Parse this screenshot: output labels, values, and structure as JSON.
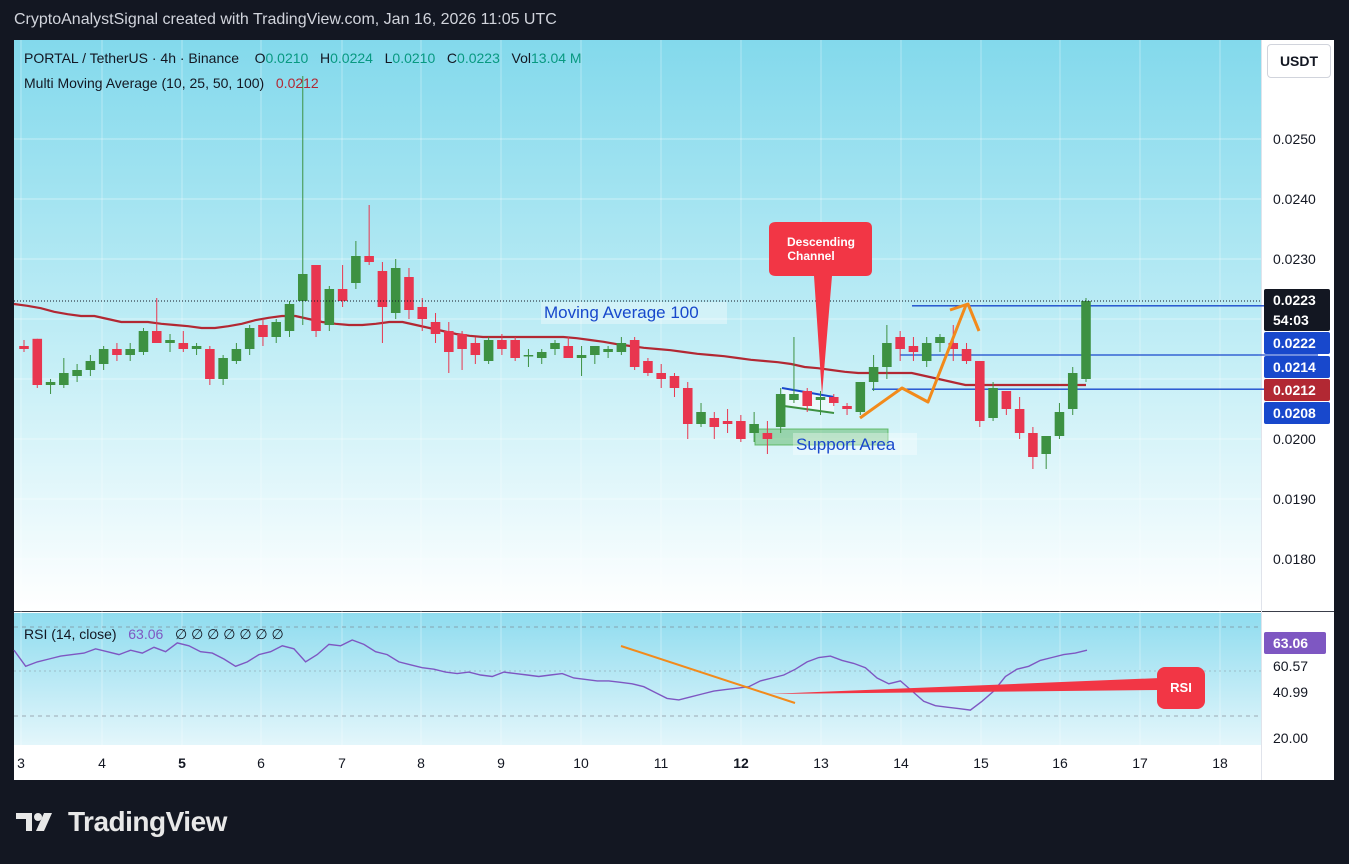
{
  "header": {
    "credit": "CryptoAnalystSignal created with TradingView.com, Jan 16, 2026 11:05 UTC"
  },
  "legend": {
    "symbol": "PORTAL / TetherUS · 4h · Binance",
    "o_label": "O",
    "o_value": "0.0210",
    "h_label": "H",
    "h_value": "0.0224",
    "l_label": "L",
    "l_value": "0.0210",
    "c_label": "C",
    "c_value": "0.0223",
    "vol_label": "Vol",
    "vol_value": "13.04 M",
    "ma_label": "Multi Moving Average (10, 25, 50, 100)",
    "ma_value": "0.0212"
  },
  "currency_button": "USDT",
  "rsi_legend": {
    "label": "RSI (14, close)",
    "value": "63.06",
    "extra": "∅ ∅ ∅ ∅ ∅ ∅ ∅"
  },
  "annotations": {
    "moving_average": "Moving Average 100",
    "support_area": "Support Area",
    "descending_channel_line1": "Descending",
    "descending_channel_line2": "Channel",
    "rsi_callout": "RSI"
  },
  "price_badges": {
    "last": "0.0223",
    "countdown": "54:03",
    "level_upper": "0.0222",
    "level_mid": "0.0214",
    "ma100": "0.0212",
    "level_lower": "0.0208"
  },
  "rsi_badges": {
    "current": "63.06",
    "b1": "60.57",
    "b2": "40.99",
    "b3": "20.00"
  },
  "colors": {
    "up": "#3d9142",
    "down": "#e8364f",
    "ma100": "#b22833",
    "rsi": "#7e57c2",
    "annotation_blue": "#1848cc",
    "annotation_orange": "#f28a1b",
    "callout_red": "#f23645"
  },
  "brand": {
    "name": "TradingView",
    "icon": "tradingview-logo-icon"
  },
  "chart_data": [
    {
      "type": "candlestick",
      "price_axis": {
        "ticks": [
          "0.0180",
          "0.0190",
          "0.0200",
          "0.0230",
          "0.0240",
          "0.0250"
        ],
        "ylim": [
          0.0172,
          0.0262
        ]
      },
      "time_axis": {
        "ticks": [
          "3",
          "4",
          "5",
          "6",
          "7",
          "8",
          "9",
          "10",
          "11",
          "12",
          "13",
          "14",
          "15",
          "16",
          "17",
          "18"
        ]
      },
      "grid": true,
      "candles": [
        {
          "o": 0.02155,
          "h": 0.02165,
          "l": 0.02145,
          "c": 0.0215
        },
        {
          "o": 0.02167,
          "h": 0.02167,
          "l": 0.02085,
          "c": 0.0209
        },
        {
          "o": 0.0209,
          "h": 0.021,
          "l": 0.02075,
          "c": 0.02095
        },
        {
          "o": 0.0209,
          "h": 0.02135,
          "l": 0.02085,
          "c": 0.0211
        },
        {
          "o": 0.02105,
          "h": 0.02125,
          "l": 0.02095,
          "c": 0.02115
        },
        {
          "o": 0.02115,
          "h": 0.0214,
          "l": 0.02105,
          "c": 0.0213
        },
        {
          "o": 0.02125,
          "h": 0.02155,
          "l": 0.02115,
          "c": 0.0215
        },
        {
          "o": 0.0215,
          "h": 0.0216,
          "l": 0.0213,
          "c": 0.0214
        },
        {
          "o": 0.0214,
          "h": 0.0216,
          "l": 0.0213,
          "c": 0.0215
        },
        {
          "o": 0.02145,
          "h": 0.02185,
          "l": 0.0214,
          "c": 0.0218
        },
        {
          "o": 0.0218,
          "h": 0.02235,
          "l": 0.0216,
          "c": 0.0216
        },
        {
          "o": 0.0216,
          "h": 0.02175,
          "l": 0.02145,
          "c": 0.02165
        },
        {
          "o": 0.0216,
          "h": 0.0218,
          "l": 0.02145,
          "c": 0.0215
        },
        {
          "o": 0.0215,
          "h": 0.0216,
          "l": 0.0214,
          "c": 0.02155
        },
        {
          "o": 0.0215,
          "h": 0.02155,
          "l": 0.0209,
          "c": 0.021
        },
        {
          "o": 0.021,
          "h": 0.0214,
          "l": 0.0209,
          "c": 0.02135
        },
        {
          "o": 0.0213,
          "h": 0.0216,
          "l": 0.02125,
          "c": 0.0215
        },
        {
          "o": 0.0215,
          "h": 0.0219,
          "l": 0.0214,
          "c": 0.02185
        },
        {
          "o": 0.0219,
          "h": 0.022,
          "l": 0.02155,
          "c": 0.0217
        },
        {
          "o": 0.0217,
          "h": 0.022,
          "l": 0.0216,
          "c": 0.02195
        },
        {
          "o": 0.0218,
          "h": 0.0223,
          "l": 0.0217,
          "c": 0.02225
        },
        {
          "o": 0.0223,
          "h": 0.02605,
          "l": 0.0219,
          "c": 0.02275
        },
        {
          "o": 0.0229,
          "h": 0.0229,
          "l": 0.0217,
          "c": 0.0218
        },
        {
          "o": 0.0219,
          "h": 0.02255,
          "l": 0.0218,
          "c": 0.0225
        },
        {
          "o": 0.0225,
          "h": 0.0229,
          "l": 0.0222,
          "c": 0.0223
        },
        {
          "o": 0.0226,
          "h": 0.0233,
          "l": 0.0225,
          "c": 0.02305
        },
        {
          "o": 0.02305,
          "h": 0.0239,
          "l": 0.0229,
          "c": 0.02295
        },
        {
          "o": 0.0228,
          "h": 0.02295,
          "l": 0.0216,
          "c": 0.0222
        },
        {
          "o": 0.0221,
          "h": 0.023,
          "l": 0.022,
          "c": 0.02285
        },
        {
          "o": 0.0227,
          "h": 0.02285,
          "l": 0.022,
          "c": 0.02215
        },
        {
          "o": 0.0222,
          "h": 0.02235,
          "l": 0.0218,
          "c": 0.022
        },
        {
          "o": 0.02195,
          "h": 0.0221,
          "l": 0.0216,
          "c": 0.02175
        },
        {
          "o": 0.0218,
          "h": 0.02195,
          "l": 0.0211,
          "c": 0.02145
        },
        {
          "o": 0.02175,
          "h": 0.0218,
          "l": 0.02115,
          "c": 0.0215
        },
        {
          "o": 0.0216,
          "h": 0.0217,
          "l": 0.02125,
          "c": 0.0214
        },
        {
          "o": 0.0213,
          "h": 0.0217,
          "l": 0.02125,
          "c": 0.02165
        },
        {
          "o": 0.02165,
          "h": 0.02175,
          "l": 0.0214,
          "c": 0.0215
        },
        {
          "o": 0.02165,
          "h": 0.0217,
          "l": 0.0213,
          "c": 0.02135
        },
        {
          "o": 0.0214,
          "h": 0.0215,
          "l": 0.0212,
          "c": 0.0214
        },
        {
          "o": 0.02135,
          "h": 0.0215,
          "l": 0.02125,
          "c": 0.02145
        },
        {
          "o": 0.0215,
          "h": 0.02165,
          "l": 0.0214,
          "c": 0.0216
        },
        {
          "o": 0.02155,
          "h": 0.0217,
          "l": 0.02135,
          "c": 0.02135
        },
        {
          "o": 0.02135,
          "h": 0.02155,
          "l": 0.02105,
          "c": 0.0214
        },
        {
          "o": 0.0214,
          "h": 0.02155,
          "l": 0.02125,
          "c": 0.02155
        },
        {
          "o": 0.02145,
          "h": 0.02155,
          "l": 0.02135,
          "c": 0.0215
        },
        {
          "o": 0.02145,
          "h": 0.0217,
          "l": 0.0214,
          "c": 0.0216
        },
        {
          "o": 0.02165,
          "h": 0.0217,
          "l": 0.02115,
          "c": 0.0212
        },
        {
          "o": 0.0213,
          "h": 0.02135,
          "l": 0.02105,
          "c": 0.0211
        },
        {
          "o": 0.0211,
          "h": 0.02125,
          "l": 0.02085,
          "c": 0.021
        },
        {
          "o": 0.02105,
          "h": 0.0211,
          "l": 0.0207,
          "c": 0.02085
        },
        {
          "o": 0.02085,
          "h": 0.02095,
          "l": 0.02,
          "c": 0.02025
        },
        {
          "o": 0.02025,
          "h": 0.0206,
          "l": 0.0202,
          "c": 0.02045
        },
        {
          "o": 0.02035,
          "h": 0.02045,
          "l": 0.02,
          "c": 0.0202
        },
        {
          "o": 0.0203,
          "h": 0.0205,
          "l": 0.0201,
          "c": 0.02025
        },
        {
          "o": 0.0203,
          "h": 0.0204,
          "l": 0.01995,
          "c": 0.02
        },
        {
          "o": 0.0201,
          "h": 0.02045,
          "l": 0.01995,
          "c": 0.02025
        },
        {
          "o": 0.0201,
          "h": 0.0203,
          "l": 0.01975,
          "c": 0.02
        },
        {
          "o": 0.0202,
          "h": 0.02085,
          "l": 0.0201,
          "c": 0.02075
        },
        {
          "o": 0.02065,
          "h": 0.0217,
          "l": 0.0206,
          "c": 0.02075
        },
        {
          "o": 0.0208,
          "h": 0.02085,
          "l": 0.02045,
          "c": 0.02055
        },
        {
          "o": 0.02065,
          "h": 0.0208,
          "l": 0.0204,
          "c": 0.0207
        },
        {
          "o": 0.0207,
          "h": 0.02075,
          "l": 0.02055,
          "c": 0.0206
        },
        {
          "o": 0.02055,
          "h": 0.0206,
          "l": 0.0204,
          "c": 0.0205
        },
        {
          "o": 0.02045,
          "h": 0.02095,
          "l": 0.0204,
          "c": 0.02095
        },
        {
          "o": 0.02095,
          "h": 0.0214,
          "l": 0.0208,
          "c": 0.0212
        },
        {
          "o": 0.0212,
          "h": 0.0219,
          "l": 0.021,
          "c": 0.0216
        },
        {
          "o": 0.0217,
          "h": 0.0218,
          "l": 0.0213,
          "c": 0.0215
        },
        {
          "o": 0.02155,
          "h": 0.0217,
          "l": 0.0213,
          "c": 0.02145
        },
        {
          "o": 0.0213,
          "h": 0.0217,
          "l": 0.0212,
          "c": 0.0216
        },
        {
          "o": 0.0216,
          "h": 0.02175,
          "l": 0.02145,
          "c": 0.0217
        },
        {
          "o": 0.0216,
          "h": 0.0219,
          "l": 0.0213,
          "c": 0.0215
        },
        {
          "o": 0.0215,
          "h": 0.0216,
          "l": 0.02125,
          "c": 0.0213
        },
        {
          "o": 0.0213,
          "h": 0.0213,
          "l": 0.0202,
          "c": 0.0203
        },
        {
          "o": 0.02035,
          "h": 0.02095,
          "l": 0.0203,
          "c": 0.02085
        },
        {
          "o": 0.0208,
          "h": 0.0208,
          "l": 0.0204,
          "c": 0.0205
        },
        {
          "o": 0.0205,
          "h": 0.0207,
          "l": 0.02,
          "c": 0.0201
        },
        {
          "o": 0.0201,
          "h": 0.0202,
          "l": 0.0195,
          "c": 0.0197
        },
        {
          "o": 0.01975,
          "h": 0.02005,
          "l": 0.0195,
          "c": 0.02005
        },
        {
          "o": 0.02005,
          "h": 0.0206,
          "l": 0.02,
          "c": 0.02045
        },
        {
          "o": 0.0205,
          "h": 0.0212,
          "l": 0.0204,
          "c": 0.0211
        },
        {
          "o": 0.021,
          "h": 0.02235,
          "l": 0.02095,
          "c": 0.0223
        }
      ],
      "moving_average_100": [
        0.02225,
        0.02222,
        0.02218,
        0.02212,
        0.02208,
        0.02205,
        0.02205,
        0.022,
        0.02195,
        0.02195,
        0.02195,
        0.02192,
        0.0219,
        0.02188,
        0.02185,
        0.02185,
        0.02188,
        0.02192,
        0.02198,
        0.02202,
        0.02205,
        0.02205,
        0.022,
        0.02195,
        0.02192,
        0.0219,
        0.0219,
        0.02192,
        0.02195,
        0.02195,
        0.0219,
        0.02185,
        0.0218,
        0.02175,
        0.02172,
        0.0217,
        0.0217,
        0.0217,
        0.0217,
        0.0217,
        0.0217,
        0.0217,
        0.02168,
        0.02165,
        0.02162,
        0.02158,
        0.02155,
        0.02152,
        0.0215,
        0.02148,
        0.02145,
        0.02142,
        0.0214,
        0.02138,
        0.02135,
        0.02132,
        0.0213,
        0.02128,
        0.02125,
        0.0212,
        0.02118,
        0.02115,
        0.02112,
        0.0211,
        0.0211,
        0.0211,
        0.0211,
        0.0211,
        0.02105,
        0.021,
        0.02095,
        0.0209,
        0.0209,
        0.0209,
        0.0209,
        0.0209,
        0.0209,
        0.0209,
        0.0209,
        0.0209,
        0.0209
      ]
    },
    {
      "type": "line",
      "name": "RSI (14, close)",
      "ylim": [
        10,
        80
      ],
      "levels": [
        60.57,
        40.99,
        20.0
      ],
      "values": [
        63,
        52,
        55,
        57,
        59,
        60,
        61,
        64,
        62,
        60,
        63,
        61,
        65,
        62,
        68,
        66,
        62,
        61,
        57,
        52,
        55,
        60,
        62,
        66,
        64,
        55,
        60,
        67,
        66,
        70,
        67,
        62,
        60,
        55,
        53,
        51,
        50,
        48,
        47,
        48,
        46,
        45,
        48,
        47,
        46,
        45,
        46,
        47,
        44,
        43,
        42,
        42,
        41,
        40,
        38,
        34,
        30,
        29,
        31,
        33,
        35,
        36,
        37,
        38,
        42,
        44,
        46,
        50,
        55,
        58,
        59,
        56,
        54,
        51,
        44,
        40,
        42,
        35,
        28,
        25,
        24,
        23,
        22,
        28,
        35,
        45,
        50,
        52,
        56,
        58,
        60,
        61,
        63
      ]
    }
  ]
}
